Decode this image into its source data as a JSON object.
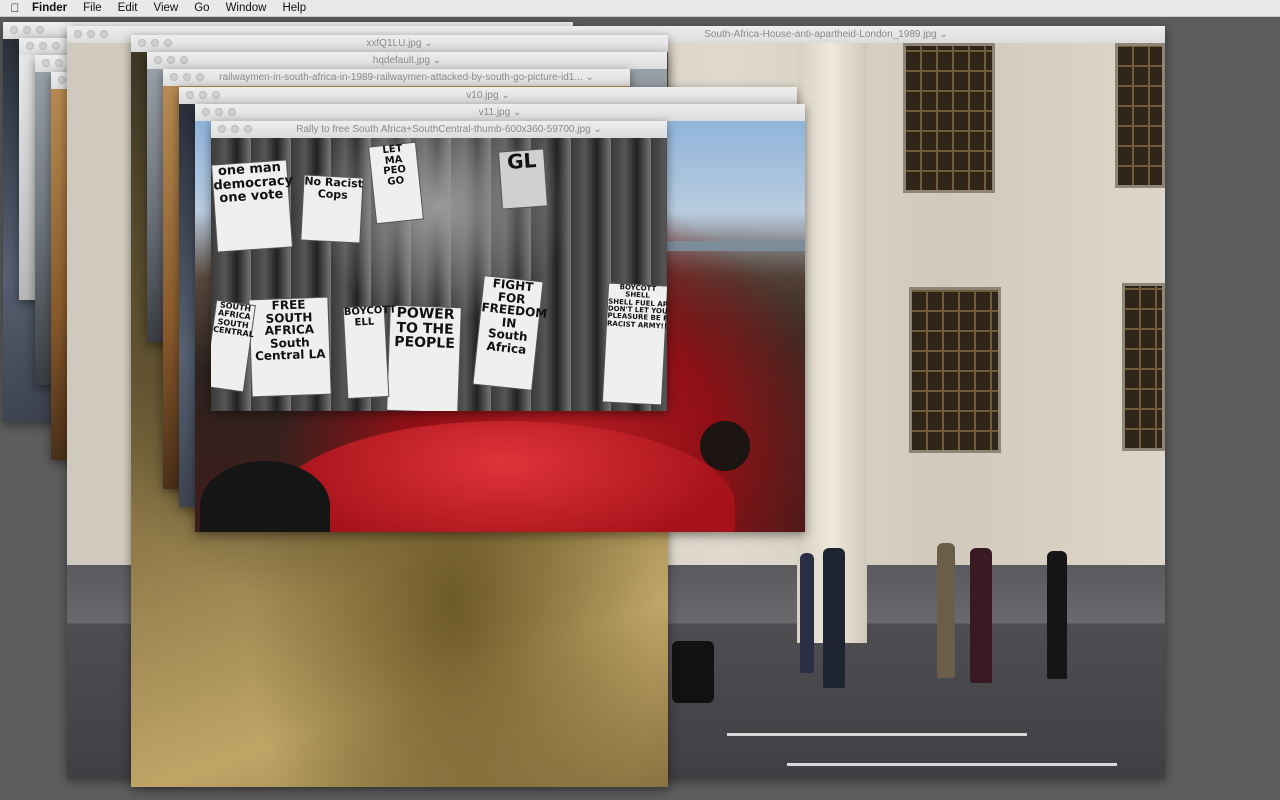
{
  "menubar": {
    "apple": "",
    "app": "Finder",
    "menus": [
      "File",
      "Edit",
      "View",
      "Go",
      "Window",
      "Help"
    ]
  },
  "windows": [
    {
      "title": "South-Africa-House-anti-apartheid-London_1989.jpg"
    },
    {
      "title": "xxfQ1LU.jpg"
    },
    {
      "title": "hqdefault.jpg"
    },
    {
      "title": "railwaymen-in-south-africa-in-1989-railwaymen-attacked-by-south-go-picture-id1..."
    },
    {
      "title": "v10.jpg"
    },
    {
      "title": "v11.jpg"
    },
    {
      "title": "Rally to free South Africa+SouthCentral-thumb-600x360-59700.jpg"
    }
  ],
  "signs": {
    "s1": "one man\ndemocracy\none vote",
    "s2": "No Racist\nCops",
    "s3": "LET\nMA\nPEO\nGO",
    "s4": "FREE\nSOUTH\nAFRICA\nSouth\nCentral LA",
    "s5": "POWER\nTO THE\nPEOPLE",
    "s6": "FIGHT\nFOR\nFREEDOM\nIN\nSouth\nAfrica",
    "s7": "Boycott\nShell",
    "s8": "BOYCOTT\nSHELL\nSHELL FUEL APARTHEID\nDON'T LET YOUR\nPLEASURE BE FUEL A\nRACIST ARMY!!",
    "s9": "SOUTH\nAFRICA\nSOUTH\nCENTRAL",
    "s10": "BOYCOTT\nELL",
    "s11": "GL"
  },
  "colors": {
    "menubar_bg": "#e9e9e9",
    "desktop": "#5d5d5d",
    "titlebar": "#e4e4e4"
  }
}
